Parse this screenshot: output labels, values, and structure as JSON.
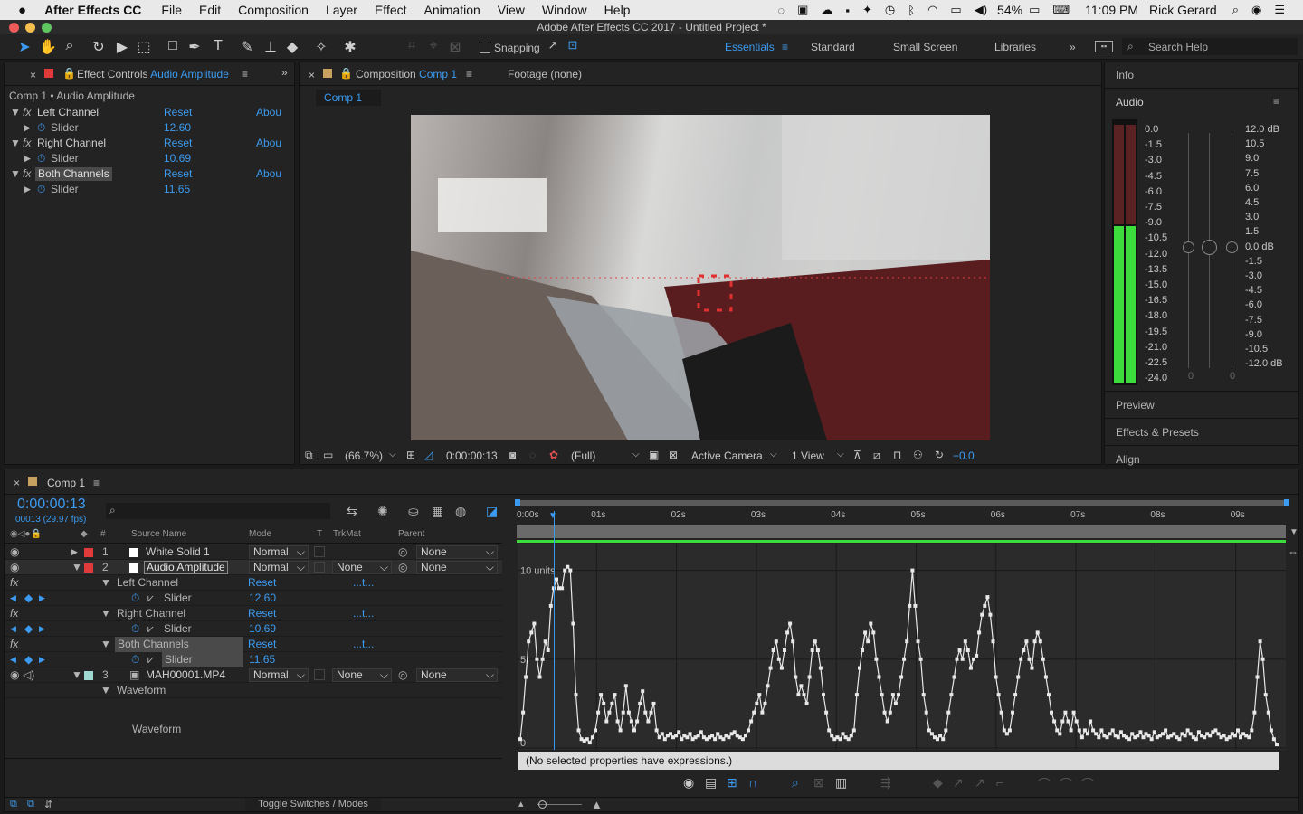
{
  "menubar": {
    "apple": "",
    "app_name": "After Effects CC",
    "items": [
      "File",
      "Edit",
      "Composition",
      "Layer",
      "Effect",
      "Animation",
      "View",
      "Window",
      "Help"
    ],
    "battery": "54%",
    "time": "11:09 PM",
    "user": "Rick Gerard"
  },
  "window": {
    "title": "Adobe After Effects CC 2017 - Untitled Project *"
  },
  "toolbar": {
    "snapping_label": "Snapping",
    "workspaces": [
      "Essentials",
      "Standard",
      "Small Screen",
      "Libraries"
    ],
    "active_workspace": "Essentials",
    "search_placeholder": "Search Help"
  },
  "effect_controls": {
    "tab_label": "Effect Controls",
    "tab_target": "Audio Amplitude",
    "breadcrumb": "Comp 1 • Audio Amplitude",
    "effects": [
      {
        "name": "Left Channel",
        "reset": "Reset",
        "about": "Abou",
        "param": "Slider",
        "value": "12.60"
      },
      {
        "name": "Right Channel",
        "reset": "Reset",
        "about": "Abou",
        "param": "Slider",
        "value": "10.69"
      },
      {
        "name": "Both Channels",
        "reset": "Reset",
        "about": "Abou",
        "param": "Slider",
        "value": "11.65"
      }
    ]
  },
  "composition": {
    "tab_label": "Composition",
    "tab_target": "Comp 1",
    "footage_tab": "Footage (none)",
    "sub_tab": "Comp 1",
    "zoom": "(66.7%)",
    "timecode": "0:00:00:13",
    "resolution": "(Full)",
    "camera": "Active Camera",
    "views": "1 View",
    "exposure": "+0.0"
  },
  "right_panel": {
    "info": "Info",
    "audio": "Audio",
    "left_scale": [
      "0.0",
      "-1.5",
      "-3.0",
      "-4.5",
      "-6.0",
      "-7.5",
      "-9.0",
      "-10.5",
      "-12.0",
      "-13.5",
      "-15.0",
      "-16.5",
      "-18.0",
      "-19.5",
      "-21.0",
      "-22.5",
      "-24.0"
    ],
    "right_scale": [
      "12.0 dB",
      "10.5",
      "9.0",
      "7.5",
      "6.0",
      "4.5",
      "3.0",
      "1.5",
      "0.0 dB",
      "-1.5",
      "-3.0",
      "-4.5",
      "-6.0",
      "-7.5",
      "-9.0",
      "-10.5",
      "-12.0 dB"
    ],
    "fader_values": [
      "0",
      "0"
    ],
    "meter_level": 0.6,
    "preview": "Preview",
    "effects_presets": "Effects & Presets",
    "align": "Align"
  },
  "timeline": {
    "tab_label": "Comp 1",
    "timecode": "0:00:00:13",
    "frame_info": "00013 (29.97 fps)",
    "headers": {
      "num": "#",
      "source": "Source Name",
      "mode": "Mode",
      "t": "T",
      "trkmat": "TrkMat",
      "parent": "Parent"
    },
    "layers": [
      {
        "num": "1",
        "name": "White Solid 1",
        "mode": "Normal",
        "trkmat": "",
        "parent": "None",
        "color": "#e03a3a"
      },
      {
        "num": "2",
        "name": "Audio Amplitude",
        "mode": "Normal",
        "trkmat": "None",
        "parent": "None",
        "color": "#e03a3a"
      },
      {
        "num": "3",
        "name": "MAH00001.MP4",
        "mode": "Normal",
        "trkmat": "None",
        "parent": "None",
        "color": "#9fd8d0"
      }
    ],
    "props": [
      {
        "group": "Left Channel",
        "reset": "Reset",
        "expr": "...t...",
        "param": "Slider",
        "value": "12.60"
      },
      {
        "group": "Right Channel",
        "reset": "Reset",
        "expr": "...t...",
        "param": "Slider",
        "value": "10.69"
      },
      {
        "group": "Both Channels",
        "reset": "Reset",
        "expr": "...t...",
        "param": "Slider",
        "value": "11.65"
      }
    ],
    "waveform_group": "Waveform",
    "waveform_label": "Waveform",
    "toggle_label": "Toggle Switches / Modes",
    "ruler": [
      "0:00s",
      "01s",
      "02s",
      "03s",
      "04s",
      "05s",
      "06s",
      "07s",
      "08s",
      "09s"
    ],
    "expression_status": "(No selected properties have expressions.)"
  },
  "chart_data": {
    "type": "line",
    "title": "",
    "ylabel": "",
    "y_tick_labels": [
      "10 units",
      "5",
      "0"
    ],
    "ylim": [
      0,
      11
    ],
    "x_unit": "frames",
    "xlim": [
      0,
      300
    ],
    "values": [
      0.5,
      2,
      4,
      6,
      6.5,
      7,
      5,
      4,
      5,
      6,
      5.5,
      8,
      9,
      9.5,
      9,
      9,
      10,
      10.2,
      10,
      7,
      3,
      1,
      0.5,
      0.4,
      0.5,
      0.3,
      0.6,
      1,
      2,
      3,
      2.5,
      1.5,
      2,
      2.5,
      3,
      1.5,
      1,
      2,
      3.5,
      2,
      1.5,
      1,
      1.5,
      2.5,
      3.2,
      2,
      1.5,
      2,
      2.5,
      1,
      0.6,
      0.8,
      0.5,
      0.7,
      0.8,
      0.6,
      0.7,
      0.9,
      0.5,
      0.7,
      0.6,
      0.8,
      0.5,
      0.6,
      0.7,
      0.9,
      0.6,
      0.5,
      0.6,
      0.7,
      0.5,
      0.8,
      0.6,
      0.5,
      0.7,
      0.6,
      0.8,
      0.9,
      0.7,
      0.6,
      0.5,
      0.7,
      1,
      1.5,
      2,
      2.5,
      3,
      2,
      2.5,
      3.5,
      4.5,
      5.5,
      6,
      5,
      4.5,
      5.5,
      6.5,
      7,
      6,
      4,
      3,
      3.5,
      3,
      2.5,
      4,
      5.5,
      6,
      5.5,
      4.5,
      3,
      2,
      1,
      0.7,
      0.5,
      0.6,
      0.5,
      0.8,
      0.6,
      0.5,
      0.7,
      1,
      3,
      4.5,
      5.5,
      6.5,
      6,
      7,
      6.5,
      5,
      4,
      3,
      2,
      1.5,
      2,
      3,
      2.5,
      3,
      4,
      5,
      6,
      8,
      10,
      8,
      6,
      5,
      3,
      2,
      1,
      0.8,
      0.6,
      0.5,
      0.7,
      0.5,
      1,
      2,
      3,
      4,
      5,
      5.5,
      5,
      6,
      5.5,
      4.5,
      5,
      5.2,
      6.5,
      7.5,
      8,
      8.5,
      7.5,
      6,
      4,
      3,
      2,
      1,
      0.8,
      1,
      2,
      3,
      4,
      5,
      5.5,
      6,
      5,
      4.5,
      6,
      6.5,
      6,
      5,
      4,
      3,
      2,
      1.5,
      1,
      0.8,
      1.5,
      2,
      1.5,
      1,
      2,
      1.5,
      1,
      0.6,
      1,
      0.8,
      1.5,
      1,
      0.8,
      0.6,
      1,
      0.7,
      0.6,
      0.8,
      1,
      0.7,
      0.6,
      0.9,
      0.7,
      0.6,
      0.5,
      0.8,
      0.6,
      0.7,
      0.9,
      0.6,
      0.8,
      0.7,
      0.5,
      0.9,
      0.6,
      0.7,
      0.8,
      1,
      0.6,
      0.7,
      0.8,
      0.6,
      0.5,
      0.8,
      0.7,
      1,
      0.8,
      0.6,
      0.5,
      0.9,
      0.7,
      0.6,
      0.8,
      0.7,
      0.9,
      1,
      0.8,
      0.6,
      0.7,
      0.5,
      0.6,
      0.8,
      0.7,
      1,
      0.6,
      0.8,
      0.7,
      0.6,
      1,
      2,
      4,
      6,
      5,
      3,
      2,
      1,
      0.5,
      0.2
    ]
  },
  "colors": {
    "accent": "#3c9bf0",
    "menubar": "#e9e9e9",
    "panel": "#232323",
    "meter_green": "#3ddc3d",
    "keyframe": "#3c9bf0"
  }
}
